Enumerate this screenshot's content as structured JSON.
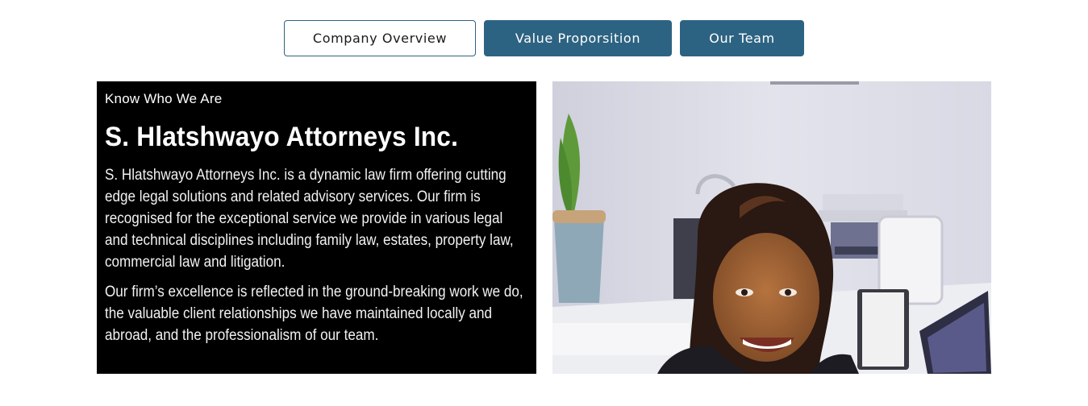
{
  "tabs": {
    "overview": "Company Overview",
    "value": "Value Proporsition",
    "team": "Our Team"
  },
  "about": {
    "eyebrow": "Know Who We Are",
    "title": "S. Hlatshwayo Attorneys Inc.",
    "paragraph_1": "S. Hlatshwayo Attorneys Inc. is a dynamic law firm offering cutting edge legal solutions and related advisory services. Our firm is recognised for the exceptional service we provide in various legal and technical disciplines including family law, estates, property law, commercial law and litigation.",
    "paragraph_2": "Our firm’s excellence is reflected in the ground-breaking work we do, the valuable client relationships we have maintained locally and abroad, and the professionalism of our team."
  },
  "colors": {
    "accent": "#2d6382",
    "panel_bg": "#000000"
  }
}
